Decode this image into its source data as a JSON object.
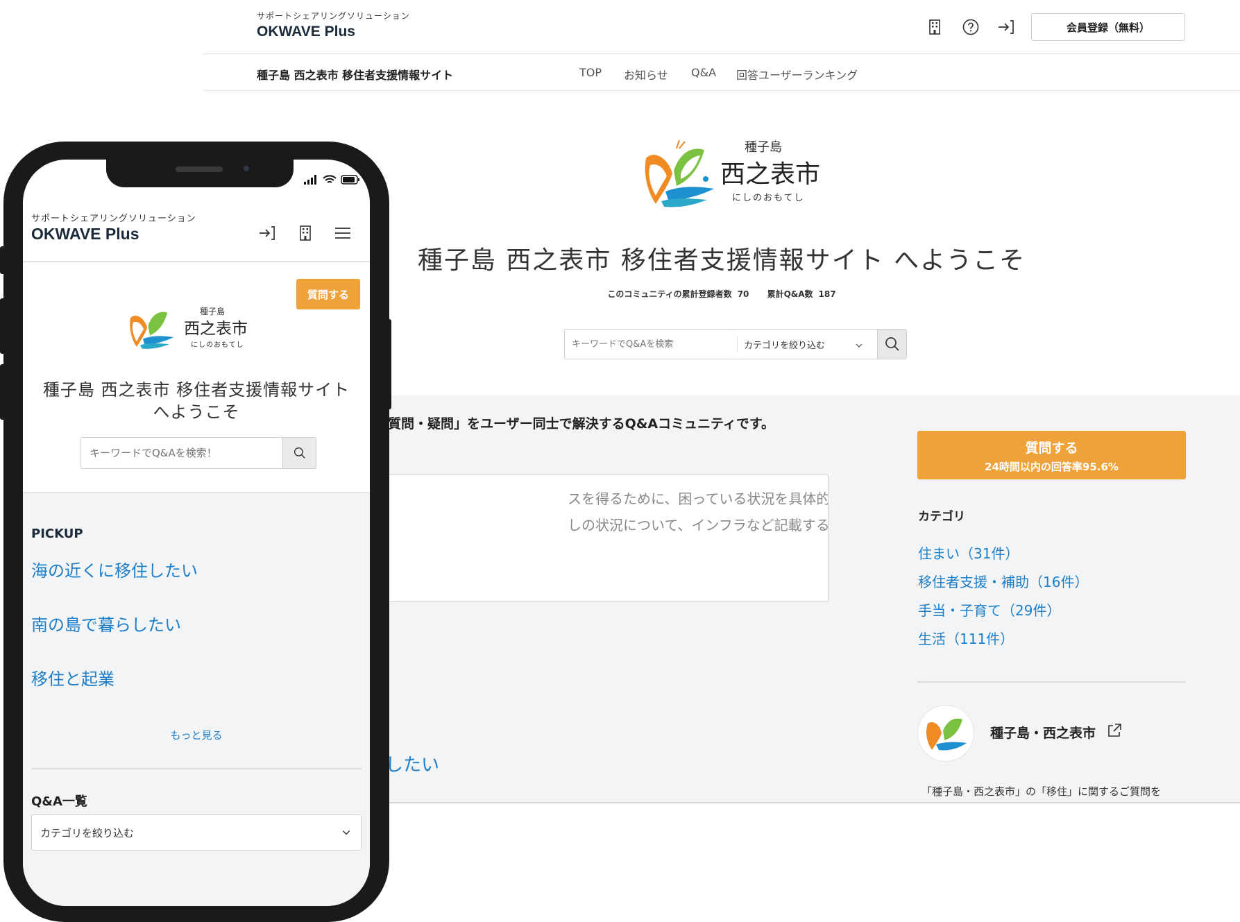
{
  "desktop": {
    "brand_sub": "サポートシェアリングソリューション",
    "brand": "OKWAVE Plus",
    "register_label": "会員登録（無料）",
    "site_name": "種子島 西之表市 移住者支援情報サイト",
    "nav": [
      "TOP",
      "お知らせ",
      "Q&A",
      "回答ユーザーランキング"
    ],
    "logo": {
      "top": "種子島",
      "main": "西之表市",
      "sub": "にしのおもてし"
    },
    "hero_title": "種子島 西之表市 移住者支援情報サイト へようこそ",
    "stats": {
      "members_label": "このコミュニティの累計登録者数",
      "members_value": "70",
      "qa_label": "累計Q&A数",
      "qa_value": "187"
    },
    "search_placeholder": "キーワードでQ&Aを検索",
    "category_filter": "カテゴリを絞り込む",
    "intro_partial": "質問・疑問」をユーザー同士で解決するQ&Aコミュニティです。",
    "textarea_lines": [
      "スを得るために、困っている状況を具体的に書きましょう。移",
      "しの状況について、インフラなど記載すると回答者が回答しや"
    ],
    "pickup_partial": "したい",
    "ask": {
      "label": "質問する",
      "sub": "24時間以内の回答率95.6%"
    },
    "category_heading": "カテゴリ",
    "categories": [
      "住まい（31件）",
      "移住者支援・補助（16件）",
      "手当・子育て（29件）",
      "生活（111件）"
    ],
    "city_name": "種子島・西之表市",
    "city_desc": "「種子島・西之表市」の「移住」に関するご質問を"
  },
  "mobile": {
    "brand_sub": "サポートシェアリングソリューション",
    "brand": "OKWAVE Plus",
    "ask_label": "質問する",
    "logo": {
      "top": "種子島",
      "main": "西之表市",
      "sub": "にしのおもてし"
    },
    "title_line1": "種子島 西之表市 移住者支援情報サイト",
    "title_line2": "へようこそ",
    "search_placeholder": "キーワードでQ&Aを検索！",
    "pickup_heading": "PICKUP",
    "pickup_items": [
      "海の近くに移住したい",
      "南の島で暮らしたい",
      "移住と起業"
    ],
    "more_label": "もっと見る",
    "qa_heading": "Q&A一覧",
    "category_filter": "カテゴリを絞り込む"
  },
  "colors": {
    "accent": "#f0a23a",
    "link": "#1e7ec8",
    "brand": "#1b2a3a",
    "band": "#f3f4f6"
  }
}
